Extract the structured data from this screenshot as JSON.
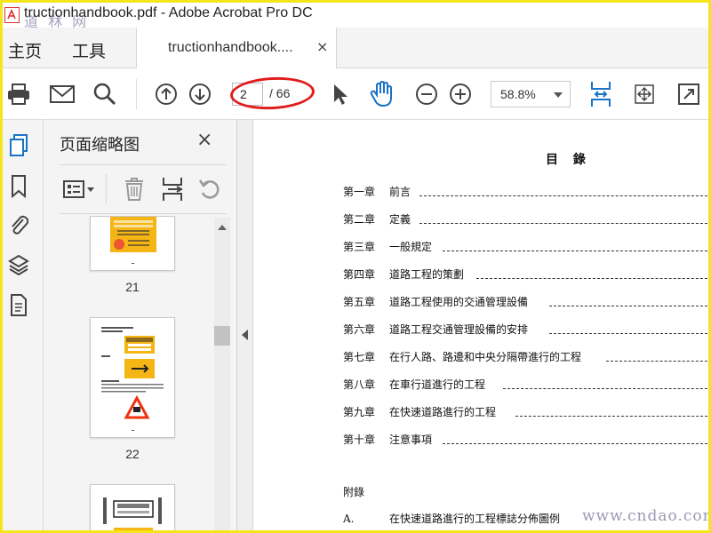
{
  "window": {
    "title": "tructionhandbook.pdf - Adobe Acrobat Pro DC",
    "watermark_top": "道 林 网",
    "watermark_bottom": "www.cndao.com"
  },
  "menu": {
    "home": "主页",
    "tools": "工具",
    "tab_label": "tructionhandbook....",
    "tab_close": "×"
  },
  "toolbar": {
    "page_current": "2",
    "page_total": "/ 66",
    "zoom": "58.8%",
    "icons": [
      "print-icon",
      "email-icon",
      "search-icon",
      "page-up-icon",
      "page-down-icon",
      "select-cursor-icon",
      "hand-tool-icon",
      "zoom-out-icon",
      "zoom-in-icon",
      "fit-page-icon",
      "fullscreen-fit-icon",
      "read-mode-icon"
    ]
  },
  "rail": {
    "icons": [
      "page-thumbnails-icon",
      "bookmarks-icon",
      "attachments-icon",
      "layers-icon",
      "document-icon"
    ]
  },
  "panel": {
    "title": "页面缩略图",
    "close": "×",
    "thumbnails": [
      {
        "number": "21"
      },
      {
        "number": "22"
      }
    ]
  },
  "document": {
    "toc_title": "目 錄",
    "toc": [
      {
        "chapter": "第一章",
        "name": "前言"
      },
      {
        "chapter": "第二章",
        "name": "定義"
      },
      {
        "chapter": "第三章",
        "name": "一般規定"
      },
      {
        "chapter": "第四章",
        "name": "道路工程的策劃"
      },
      {
        "chapter": "第五章",
        "name": "道路工程使用的交通管理設備"
      },
      {
        "chapter": "第六章",
        "name": "道路工程交通管理設備的安排"
      },
      {
        "chapter": "第七章",
        "name": "在行人路、路邊和中央分隔帶進行的工程"
      },
      {
        "chapter": "第八章",
        "name": "在車行道進行的工程"
      },
      {
        "chapter": "第九章",
        "name": "在快速道路進行的工程"
      },
      {
        "chapter": "第十章",
        "name": "注意事項"
      }
    ],
    "appendix_title": "附錄",
    "appendix_item": {
      "label": "A.",
      "name": "在快速道路進行的工程標誌分佈圖例"
    }
  },
  "colors": {
    "frame": "#f5e51b",
    "accent_blue": "#1a73c7",
    "annotation_red": "#e11d1d"
  }
}
